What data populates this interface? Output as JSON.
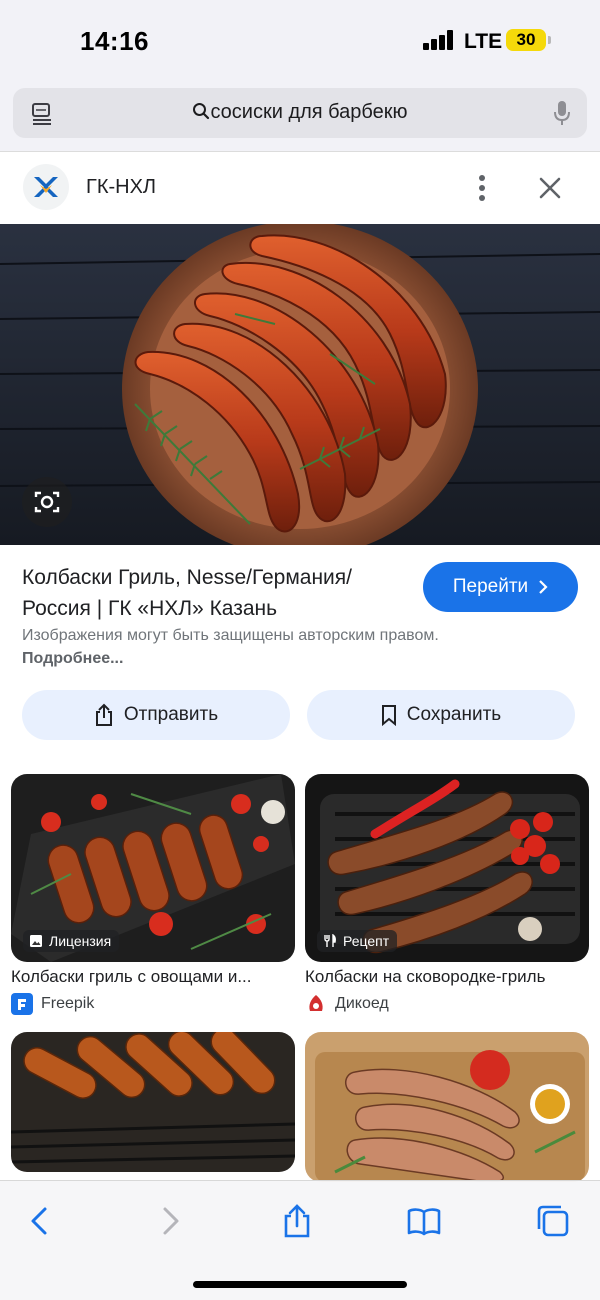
{
  "status_bar": {
    "time": "14:16",
    "network": "LTE",
    "battery": "30"
  },
  "address_bar": {
    "query": "сосиски для барбекю"
  },
  "source": {
    "name": "ГК-НХЛ"
  },
  "result": {
    "title": "Колбаски Гриль, Nesse/Германия/ Россия | ГК «НХЛ» Казань",
    "go_label": "Перейти",
    "notice_text": "Изображения могут быть защищены авторским правом.",
    "notice_link": "Подробнее...",
    "share_label": "Отправить",
    "save_label": "Сохранить"
  },
  "related": [
    {
      "title": "Колбаски гриль с овощами и...",
      "source": "Freepik",
      "badge": "Лицензия",
      "badge_icon": "image-icon"
    },
    {
      "title": "Колбаски на сковородке-гриль",
      "source": "Дикоед",
      "badge": "Рецепт",
      "badge_icon": "fork-knife-icon"
    },
    {
      "title": "",
      "source": "",
      "badge": ""
    },
    {
      "title": "",
      "source": "",
      "badge": ""
    }
  ],
  "colors": {
    "accent": "#1a73e8",
    "chip_bg": "#e8f0fe",
    "battery": "#f5d90a"
  }
}
